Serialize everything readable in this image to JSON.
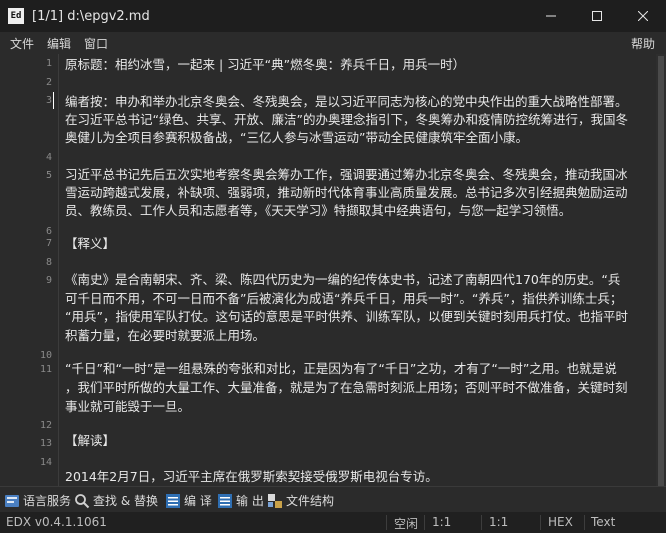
{
  "window": {
    "app_icon_text": "Ed",
    "title": "[1/1] d:\\epgv2.md"
  },
  "menu": {
    "file": "文件",
    "edit": "编辑",
    "window": "窗口",
    "help": "帮助"
  },
  "editor": {
    "line_numbers": [
      "1",
      "2",
      "3",
      "4",
      "5",
      "6",
      "7",
      "8",
      "9",
      "10",
      "11",
      "12",
      "13",
      "14"
    ],
    "lines": [
      "原标题：相约冰雪，一起来 | 习近平“典”燃冬奥：养兵千日，用兵一时）",
      "编者按：申办和举办北京冬奥会、冬残奥会，是以习近平同志为核心的党中央作出的重大战略性部署。",
      "在习近平总书记“绿色、共享、开放、廉洁”的办奥理念指引下，冬奥筹办和疫情防控统筹进行，我国冬",
      "奥健儿为全项目参赛积极备战，“三亿人参与冰雪运动”带动全民健康筑牢全面小康。",
      "习近平总书记先后五次实地考察冬奥会筹办工作，强调要通过筹办北京冬奥会、冬残奥会，推动我国冰",
      "雪运动跨越式发展，补缺项、强弱项，推动新时代体育事业高质量发展。总书记多次引经据典勉励运动",
      "员、教练员、工作人员和志愿者等，《天天学习》特撷取其中经典语句，与您一起学习领悟。",
      "【释义】",
      "《南史》是合南朝宋、齐、梁、陈四代历史为一编的纪传体史书，记述了南朝四代170年的历史。“兵",
      "可千日而不用，不可一日而不备”后被演化为成语“养兵千日，用兵一时”。“养兵”，指供养训练士兵；",
      "“用兵”，指使用军队打仗。这句话的意思是平时供养、训练军队，以便到关键时刻用兵打仗。也指平时",
      "积蓄力量，在必要时就要派上用场。",
      "“千日”和“一时”是一组悬殊的夸张和对比，正是因为有了“千日”之功，才有了“一时”之用。也就是说",
      "，我们平时所做的大量工作、大量准备，就是为了在急需时刻派上用场；否则平时不做准备，关键时刻",
      "事业就可能毁于一旦。",
      "【解读】",
      "2014年2月7日，习近平主席在俄罗斯索契接受俄罗斯电视台专访。"
    ]
  },
  "toolbar": {
    "language_service": "语言服务",
    "find_replace": "查找 & 替换",
    "translate": "编 译",
    "output": "输 出",
    "file_structure": "文件结构"
  },
  "status": {
    "version": "EDX v0.4.1.1061",
    "mode": "空闲",
    "pos1": "1:1",
    "pos2": "1:1",
    "encoding": "HEX",
    "format": "Text"
  }
}
